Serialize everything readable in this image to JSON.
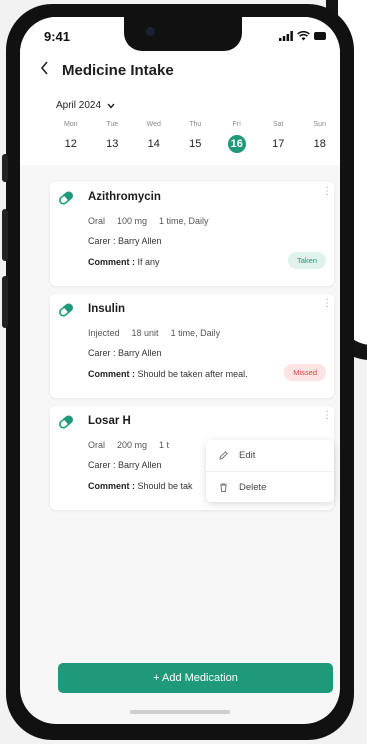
{
  "status_bar": {
    "time": "9:41"
  },
  "header": {
    "title": "Medicine Intake"
  },
  "calendar": {
    "month_label": "April 2024",
    "days": [
      {
        "name": "Mon",
        "date": "12"
      },
      {
        "name": "Tue",
        "date": "13"
      },
      {
        "name": "Wed",
        "date": "14"
      },
      {
        "name": "Thu",
        "date": "15"
      },
      {
        "name": "Fri",
        "date": "16",
        "selected": true
      },
      {
        "name": "Sat",
        "date": "17"
      },
      {
        "name": "Sun",
        "date": "18"
      }
    ]
  },
  "medications": [
    {
      "name": "Azithromycin",
      "route": "Oral",
      "dose": "100 mg",
      "frequency": "1 time, Daily",
      "carer_label": "Carer :",
      "carer": "Barry Allen",
      "comment_label": "Comment :",
      "comment": "If any",
      "status": "Taken"
    },
    {
      "name": "Insulin",
      "route": "Injected",
      "dose": "18 unit",
      "frequency": "1 time, Daily",
      "carer_label": "Carer :",
      "carer": "Barry Allen",
      "comment_label": "Comment :",
      "comment": "Should be taken after meal.",
      "status": "Missed"
    },
    {
      "name": "Losar H",
      "route": "Oral",
      "dose": "200 mg",
      "frequency": "1 t",
      "carer_label": "Carer :",
      "carer": "Barry Allen",
      "comment_label": "Comment :",
      "comment": "Should be tak",
      "status": ""
    }
  ],
  "context_menu": {
    "edit_label": "Edit",
    "delete_label": "Delete"
  },
  "add_button": {
    "label": "+ Add Medication"
  },
  "colors": {
    "accent": "#1e9a7a",
    "taken_bg": "#dff3ec",
    "missed_bg": "#fde3e3",
    "missed_text": "#e0443b"
  }
}
